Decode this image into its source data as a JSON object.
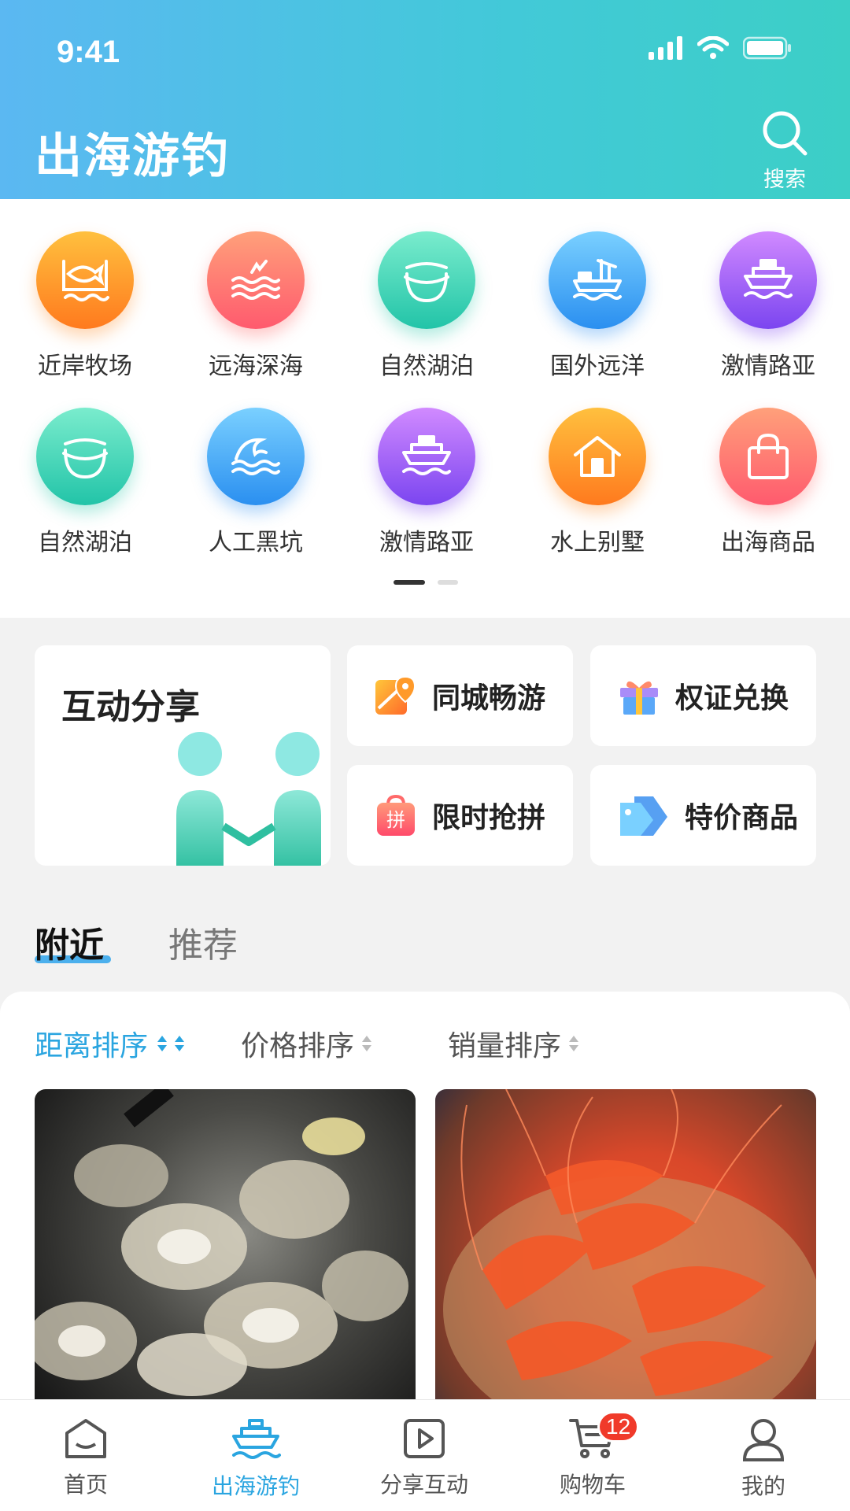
{
  "status_bar": {
    "time": "9:41"
  },
  "header": {
    "title": "出海游钓",
    "search_label": "搜索"
  },
  "categories": [
    {
      "label": "近岸牧场",
      "icon": "fish-pond-icon",
      "color_from": "#ffb23a",
      "color_to": "#ff7a1e"
    },
    {
      "label": "远海深海",
      "icon": "seagull-waves-icon",
      "color_from": "#ff9a7a",
      "color_to": "#ff5a6e"
    },
    {
      "label": "自然湖泊",
      "icon": "lake-icon",
      "color_from": "#6ee8c9",
      "color_to": "#22c4a8"
    },
    {
      "label": "国外远洋",
      "icon": "cargo-ship-icon",
      "color_from": "#68c6ff",
      "color_to": "#2a8ff0"
    },
    {
      "label": "激情路亚",
      "icon": "cruise-ship-icon",
      "color_from": "#c57bff",
      "color_to": "#7b45f0"
    },
    {
      "label": "自然湖泊",
      "icon": "lake-icon",
      "color_from": "#6ee8c9",
      "color_to": "#22c4a8"
    },
    {
      "label": "人工黑坑",
      "icon": "wave-icon",
      "color_from": "#68c6ff",
      "color_to": "#2a8ff0"
    },
    {
      "label": "激情路亚",
      "icon": "cruise-ship-icon",
      "color_from": "#c57bff",
      "color_to": "#7b45f0"
    },
    {
      "label": "水上别墅",
      "icon": "house-icon",
      "color_from": "#ffb23a",
      "color_to": "#ff7a1e"
    },
    {
      "label": "出海商品",
      "icon": "shopping-bag-icon",
      "color_from": "#ff9a7a",
      "color_to": "#ff5a6e"
    }
  ],
  "features": {
    "share_title": "互动分享",
    "tongcheng": "同城畅游",
    "quanzheng": "权证兑换",
    "xianshi": "限时抢拼",
    "xianshi_icon_text": "拼",
    "tejia": "特价商品"
  },
  "tabs": {
    "nearby": "附近",
    "recommend": "推荐"
  },
  "sort": {
    "distance": "距离排序",
    "price": "价格排序",
    "sales": "销量排序"
  },
  "products": [
    {
      "name": "oysters"
    },
    {
      "name": "shrimp"
    }
  ],
  "nav": {
    "home": "首页",
    "fishing": "出海游钓",
    "share": "分享互动",
    "cart": "购物车",
    "cart_badge": "12",
    "me": "我的"
  },
  "colors": {
    "accent": "#2aa5e0",
    "header_from": "#5bb8f2",
    "header_to": "#3ccfc6"
  }
}
